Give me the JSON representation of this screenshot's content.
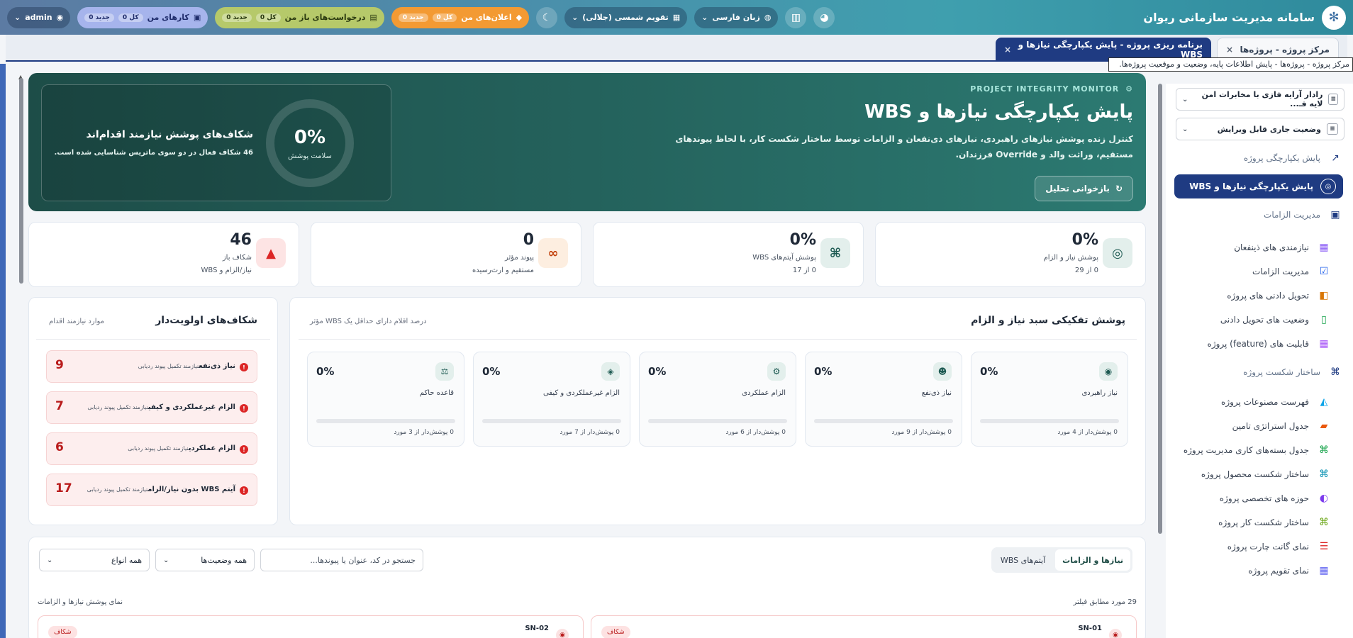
{
  "header": {
    "app_title": "سامانه مدیریت سازمانی ریوان",
    "logo_icon": "snowflake-logo-icon",
    "user": "admin",
    "tasks": {
      "label": "کارهای من",
      "all": "کل",
      "new": "جدید",
      "all_count": "0",
      "new_count": "0"
    },
    "requests": {
      "label": "درخواست‌های باز من",
      "all": "کل",
      "new": "جدید",
      "all_count": "0",
      "new_count": "0"
    },
    "announcements": {
      "label": "اعلان‌های من",
      "all": "کل",
      "new": "جدید",
      "all_count": "0",
      "new_count": "0"
    },
    "calendar": "تقویم  شمسی (جلالی)",
    "language": "زبان  فارسی",
    "colors": {
      "topbar_start": "#5c7ba3",
      "topbar_end": "#2f8a9c",
      "orange": "#f39a33",
      "lime": "#b6c96a",
      "lavender": "#a6b4ec"
    }
  },
  "tabs": {
    "inactive": "مرکز پروژه  -  پروژه‌ها",
    "active": "برنامه ریزی پروژه  -  پایش یکپارچگی نیازها و WBS",
    "close": "×",
    "tooltip": "مرکز پروژه - پروژه‌ها - پایش اطلاعات پایه، وضعیت و موقعیت پروژه‌ها."
  },
  "sidebar": {
    "project_select": "رادار آرایه فازی با مخابرات امن لایه فـ...",
    "status_select": "وضعیت جاری قابل ویرایش",
    "section_integrity": "پایش یکپارچگی پروژه",
    "active_item": "پایش یکپارچگی نیازها و WBS",
    "section_requirements": "مدیریت الزامات",
    "req_items": [
      "نیازمندی های ذینفعان",
      "مدیریت الزامات",
      "تحویل دادنی های پروژه",
      "وضعیت های تحویل دادنی",
      "قابلیت های (feature) پروژه"
    ],
    "section_wbs": "ساختار شکست پروژه",
    "wbs_items": [
      "فهرست مصنوعات پروژه",
      "جدول استراتژی تامین",
      "جدول بسته‌های کاری مدیریت پروژه",
      "ساختار شکست محصول پروژه",
      "حوزه های تخصصی پروژه",
      "ساختار شکست کار پروژه",
      "نمای گانت چارت پروژه",
      "نمای تقویم پروژه"
    ]
  },
  "hero": {
    "eyebrow": "PROJECT INTEGRITY MONITOR",
    "title": "پایش یکپارچگی نیازها و WBS",
    "description": "کنترل زنده پوشش نیازهای راهبردی، نیازهای ذی‌نفعان و الزامات توسط ساختار شکست کار، با لحاظ پیوندهای مستقیم، وراثت والد و Override فرزندان.",
    "reload_button": "بازخوانی تحلیل",
    "health_value": "0%",
    "health_label": "سلامت پوشش",
    "gap_title": "شکاف‌های پوشش نیازمند اقدام‌اند",
    "gap_subtitle": "46 شکاف فعال در دو سوی ماتریس شناسایی شده است."
  },
  "stats": [
    {
      "value": "0%",
      "label": "پوشش نیاز و الزام",
      "sub": "0 از 29",
      "icon": "target-icon",
      "color": "#1d5a52",
      "bg": "#e3efec"
    },
    {
      "value": "0%",
      "label": "پوشش آیتم‌های WBS",
      "sub": "0 از 17",
      "icon": "hierarchy-icon",
      "color": "#1d5a52",
      "bg": "#e3efec"
    },
    {
      "value": "0",
      "label": "پیوند مؤثر",
      "sub": "مستقیم و ارث‌رسیده",
      "icon": "link-icon",
      "color": "#c2410c",
      "bg": "#fdeee0"
    },
    {
      "value": "46",
      "label": "شکاف باز",
      "sub": "نیاز/الزام و WBS",
      "icon": "warning-icon",
      "color": "#dc2626",
      "bg": "#fde4e4"
    }
  ],
  "coverage": {
    "title": "پوشش تفکیکی سبد نیاز و الزام",
    "subtitle": "درصد اقلام دارای حداقل یک WBS مؤثر",
    "cards": [
      {
        "name": "نیاز راهبردی",
        "pct": "0%",
        "coverage_pct": 0,
        "foot": "0 پوشش‌دار از 4 مورد",
        "icon": "compass-icon"
      },
      {
        "name": "نیاز ذی‌نفع",
        "pct": "0%",
        "coverage_pct": 0,
        "foot": "0 پوشش‌دار از 9 مورد",
        "icon": "users-icon"
      },
      {
        "name": "الزام عملکردی",
        "pct": "0%",
        "coverage_pct": 0,
        "foot": "0 پوشش‌دار از 6 مورد",
        "icon": "gears-icon"
      },
      {
        "name": "الزام غیرعملکردی و کیفی",
        "pct": "0%",
        "coverage_pct": 0,
        "foot": "0 پوشش‌دار از 7 مورد",
        "icon": "shield-icon"
      },
      {
        "name": "قاعده حاکم",
        "pct": "0%",
        "coverage_pct": 0,
        "foot": "0 پوشش‌دار از 3 مورد",
        "icon": "scale-icon"
      }
    ]
  },
  "priority_gaps": {
    "title": "شکاف‌های اولویت‌دار",
    "subtitle": "موارد نیازمند اقدام",
    "items": [
      {
        "name": "نیاز ذی‌نفع",
        "note": "نیازمند تکمیل پیوند ردیابی",
        "count": "9"
      },
      {
        "name": "الزام غیرعملکردی و کیفی",
        "note": "نیازمند تکمیل پیوند ردیابی",
        "count": "7"
      },
      {
        "name": "الزام عملکردی",
        "note": "نیازمند تکمیل پیوند ردیابی",
        "count": "6"
      },
      {
        "name": "آیتم WBS بدون نیاز/الزام",
        "note": "نیازمند تکمیل پیوند ردیابی",
        "count": "17"
      }
    ]
  },
  "list": {
    "tab_reqs": "نیازها و الزامات",
    "tab_wbs": "آیتم‌های WBS",
    "search_placeholder": "جستجو در کد، عنوان یا پیوندها...",
    "status_filter": "همه وضعیت‌ها",
    "type_filter": "همه انواع",
    "count_text": "29 مورد مطابق فیلتر",
    "view_label": "نمای پوشش نیازها و الزامات",
    "cards": [
      {
        "code": "SN-01",
        "badge": "شکاف"
      },
      {
        "code": "SN-02",
        "badge": "شکاف"
      }
    ]
  }
}
